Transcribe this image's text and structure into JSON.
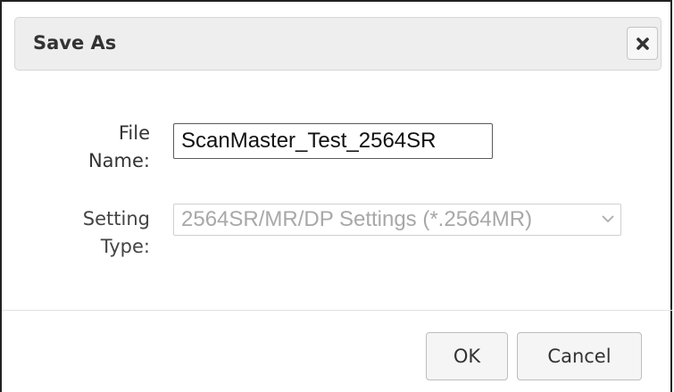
{
  "dialog": {
    "title": "Save As",
    "close_icon": "close-x-icon"
  },
  "form": {
    "file_name_label_line1": "File",
    "file_name_label_line2": "Name:",
    "file_name_value": "ScanMaster_Test_2564SR",
    "setting_type_label_line1": "Setting",
    "setting_type_label_line2": "Type:",
    "setting_type_selected": "2564SR/MR/DP Settings (*.2564MR)",
    "setting_type_disabled": true
  },
  "footer": {
    "ok_label": "OK",
    "cancel_label": "Cancel"
  },
  "colors": {
    "titlebar_bg": "#eeeeee",
    "disabled_text": "#a8a8a8",
    "text": "#333333"
  }
}
